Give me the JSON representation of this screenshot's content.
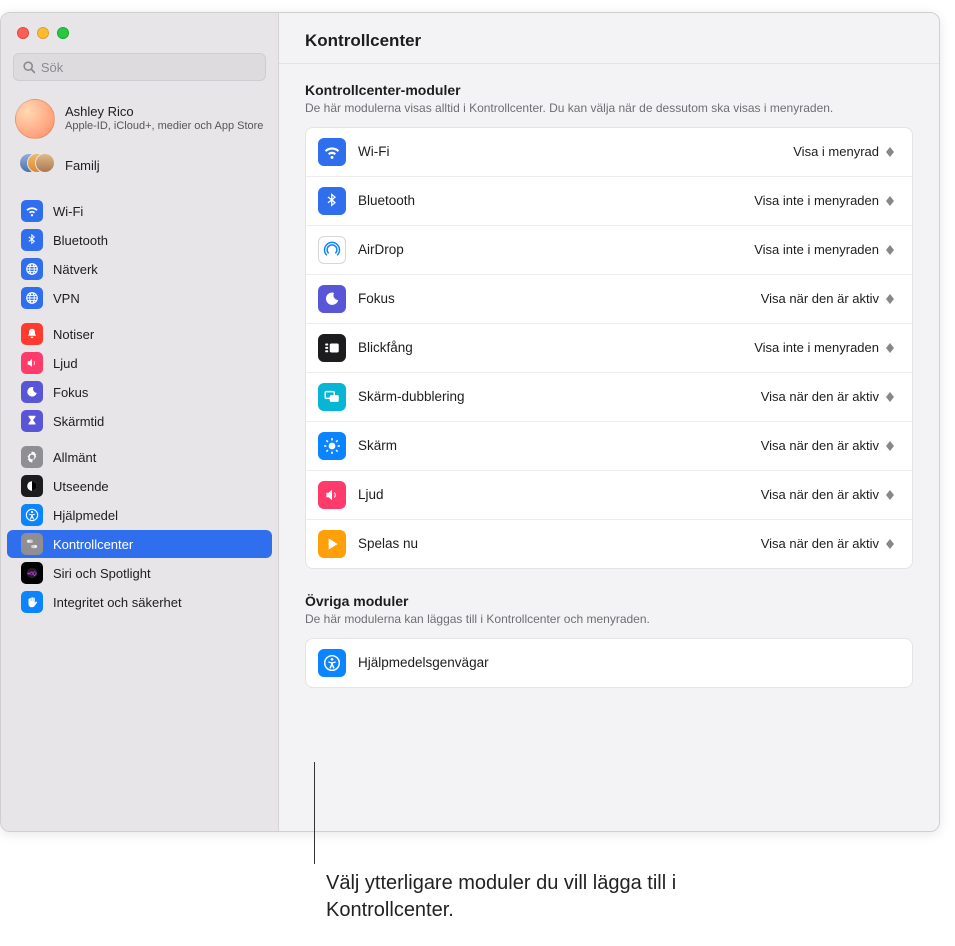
{
  "window": {
    "title": "Kontrollcenter",
    "search_placeholder": "Sök"
  },
  "account": {
    "name": "Ashley Rico",
    "sub": "Apple-ID, iCloud+, medier och App Store"
  },
  "family": {
    "label": "Familj"
  },
  "sidebar": {
    "groups": [
      {
        "items": [
          {
            "label": "Wi-Fi",
            "color": "#2f6fed",
            "icon": "wifi"
          },
          {
            "label": "Bluetooth",
            "color": "#2f6fed",
            "icon": "bluetooth"
          },
          {
            "label": "Nätverk",
            "color": "#2f6fed",
            "icon": "globe"
          },
          {
            "label": "VPN",
            "color": "#2f6fed",
            "icon": "globe"
          }
        ]
      },
      {
        "items": [
          {
            "label": "Notiser",
            "color": "#ff3b30",
            "icon": "bell"
          },
          {
            "label": "Ljud",
            "color": "#ff3b6b",
            "icon": "sound"
          },
          {
            "label": "Fokus",
            "color": "#5856d6",
            "icon": "moon"
          },
          {
            "label": "Skärmtid",
            "color": "#5856d6",
            "icon": "hourglass"
          }
        ]
      },
      {
        "items": [
          {
            "label": "Allmänt",
            "color": "#8e8e93",
            "icon": "gear"
          },
          {
            "label": "Utseende",
            "color": "#1c1c1e",
            "icon": "appearance"
          },
          {
            "label": "Hjälpmedel",
            "color": "#0a84ff",
            "icon": "accessibility"
          },
          {
            "label": "Kontrollcenter",
            "color": "#8e8e93",
            "icon": "switches",
            "selected": true
          },
          {
            "label": "Siri och Spotlight",
            "color": "#000",
            "icon": "siri"
          },
          {
            "label": "Integritet och säkerhet",
            "color": "#0a84ff",
            "icon": "hand"
          }
        ]
      }
    ]
  },
  "modules": {
    "heading": "Kontrollcenter-moduler",
    "desc": "De här modulerna visas alltid i Kontrollcenter. Du kan välja när de dessutom ska visas i menyraden.",
    "rows": [
      {
        "label": "Wi-Fi",
        "color": "#2f6fed",
        "icon": "wifi",
        "value": "Visa i menyrad"
      },
      {
        "label": "Bluetooth",
        "color": "#2f6fed",
        "icon": "bluetooth",
        "value": "Visa inte i menyraden"
      },
      {
        "label": "AirDrop",
        "color": "#ffffff",
        "icon": "airdrop",
        "value": "Visa inte i menyraden",
        "iconColor": "#0a84ff",
        "border": true
      },
      {
        "label": "Fokus",
        "color": "#5856d6",
        "icon": "moon",
        "value": "Visa när den är aktiv"
      },
      {
        "label": "Blickfång",
        "color": "#1c1c1e",
        "icon": "stage",
        "value": "Visa inte i menyraden"
      },
      {
        "label": "Skärm-dubblering",
        "color": "#06b6d4",
        "icon": "mirror",
        "value": "Visa när den är aktiv"
      },
      {
        "label": "Skärm",
        "color": "#0a84ff",
        "icon": "bright",
        "value": "Visa när den är aktiv"
      },
      {
        "label": "Ljud",
        "color": "#ff3b6b",
        "icon": "sound",
        "value": "Visa när den är aktiv"
      },
      {
        "label": "Spelas nu",
        "color": "#ff9f0a",
        "icon": "play",
        "value": "Visa när den är aktiv"
      }
    ]
  },
  "other": {
    "heading": "Övriga moduler",
    "desc": "De här modulerna kan läggas till i Kontrollcenter och menyraden.",
    "rows": [
      {
        "label": "Hjälpmedelsgenvägar",
        "color": "#0a84ff",
        "icon": "accessibility"
      }
    ]
  },
  "callout": "Välj ytterligare moduler du vill lägga till i Kontrollcenter."
}
